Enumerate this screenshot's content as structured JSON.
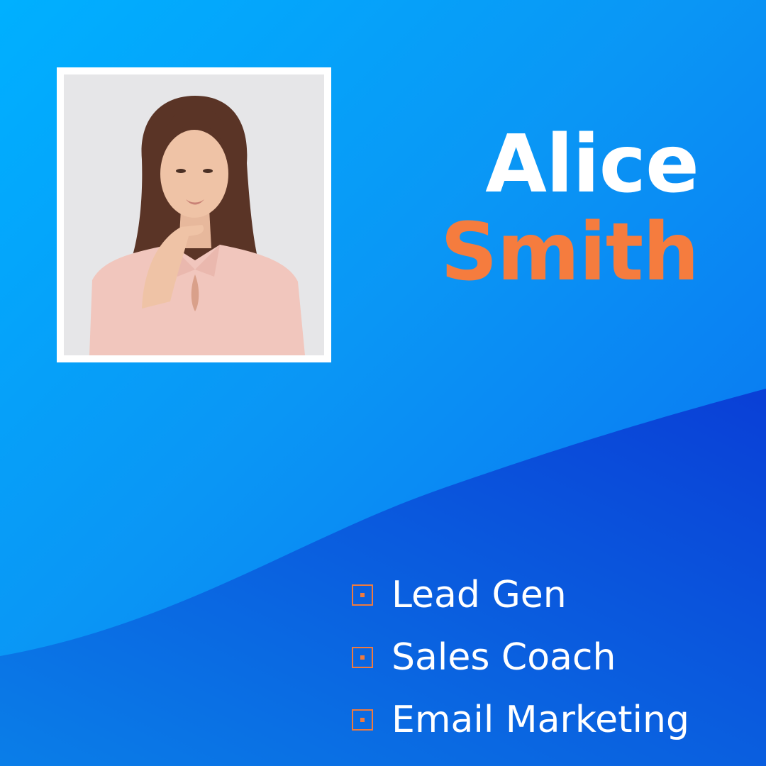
{
  "profile": {
    "first_name": "Alice",
    "last_name": "Smith"
  },
  "skills": [
    {
      "label": "Lead Gen"
    },
    {
      "label": "Sales Coach"
    },
    {
      "label": "Email Marketing"
    }
  ],
  "colors": {
    "background_light": "#00b0ff",
    "background_mid": "#0a96f5",
    "background_dark": "#0a6cf0",
    "wave_dark": "#0a3fd6",
    "first_name": "#ffffff",
    "last_name": "#f57c3e",
    "bullet": "#f07a3d",
    "skill_text": "#ffffff",
    "photo_frame": "#ffffff"
  },
  "icons": {
    "bullet": "square-dot-icon"
  }
}
